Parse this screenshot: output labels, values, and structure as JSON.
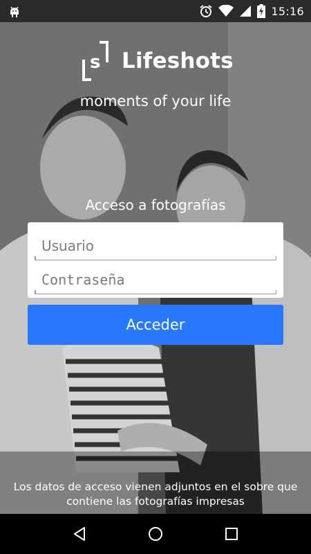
{
  "status_bar": {
    "time": "15:16",
    "icons": [
      "android-debug-icon",
      "alarm-icon",
      "wifi-icon",
      "signal-icon",
      "battery-charging-icon"
    ]
  },
  "brand": {
    "logo_letter": "s",
    "name": "Lifeshots",
    "tagline": "moments of your life"
  },
  "login": {
    "title": "Acceso a fotografías",
    "username_placeholder": "Usuario",
    "password_placeholder": "Contraseña",
    "submit_label": "Acceder"
  },
  "footer": {
    "note": "Los datos de acceso vienen adjuntos en el sobre que contiene las fotografías impresas"
  },
  "nav_bar": {
    "icons": [
      "back-icon",
      "home-icon",
      "recents-icon"
    ]
  },
  "colors": {
    "button": "#2979ff",
    "status_bar": "#2a2a2a",
    "nav_bar": "#000000"
  }
}
